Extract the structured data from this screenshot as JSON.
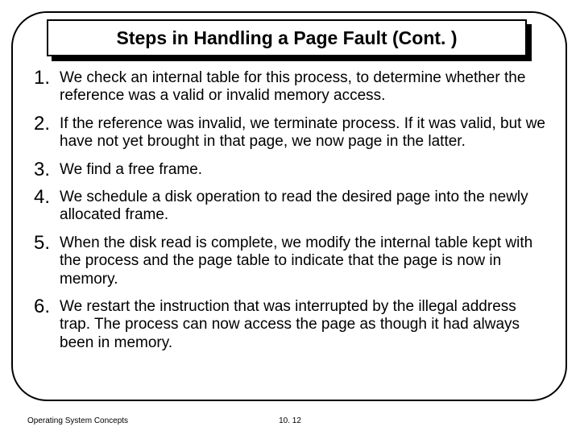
{
  "title": "Steps in Handling a Page Fault (Cont. )",
  "steps": [
    "We check an internal table for this process, to determine whether the reference was a valid or invalid memory access.",
    "If the reference was invalid, we terminate process. If it was valid, but we have not yet brought in that page, we now page in the latter.",
    "We find a free frame.",
    "We schedule a disk operation to read the desired page into the newly allocated frame.",
    "When the disk read is complete, we modify the internal table kept with the process and the page table to indicate that the page is now in memory.",
    "We restart the instruction that was interrupted by the illegal address trap. The process can now access the page as though it had always been in memory."
  ],
  "footer": {
    "left": "Operating System Concepts",
    "center": "10. 12"
  }
}
